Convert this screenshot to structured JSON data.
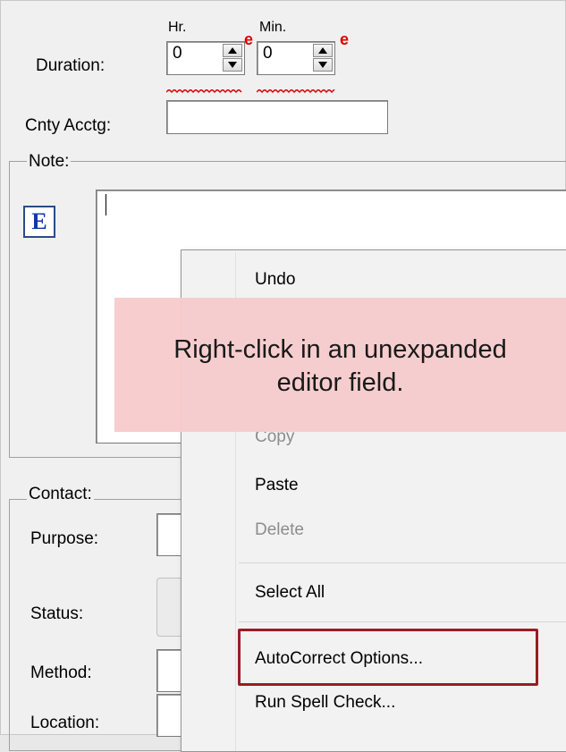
{
  "form": {
    "duration_label": "Duration:",
    "hr_label": "Hr.",
    "min_label": "Min.",
    "hr_value": "0",
    "min_value": "0",
    "required_marker": "e",
    "cnty_acctg_label": "Cnty Acctg:",
    "cnty_acctg_value": "",
    "note_label": "Note:",
    "expand_editor_label": "E",
    "contact_label": "Contact:",
    "purpose_label": "Purpose:",
    "status_label": "Status:",
    "method_label": "Method:",
    "location_label": "Location:"
  },
  "context_menu": {
    "undo": "Undo",
    "copy": "Copy",
    "paste": "Paste",
    "delete": "Delete",
    "select_all": "Select All",
    "autocorrect": "AutoCorrect Options...",
    "spell_check": "Run Spell Check..."
  },
  "callout": {
    "line1": "Right-click in an unexpanded",
    "line2": "editor field."
  },
  "colors": {
    "required": "#e00000",
    "highlight_box": "#9b1c25",
    "callout_bg": "#f7cccd",
    "expand_button": "#1436a8"
  }
}
